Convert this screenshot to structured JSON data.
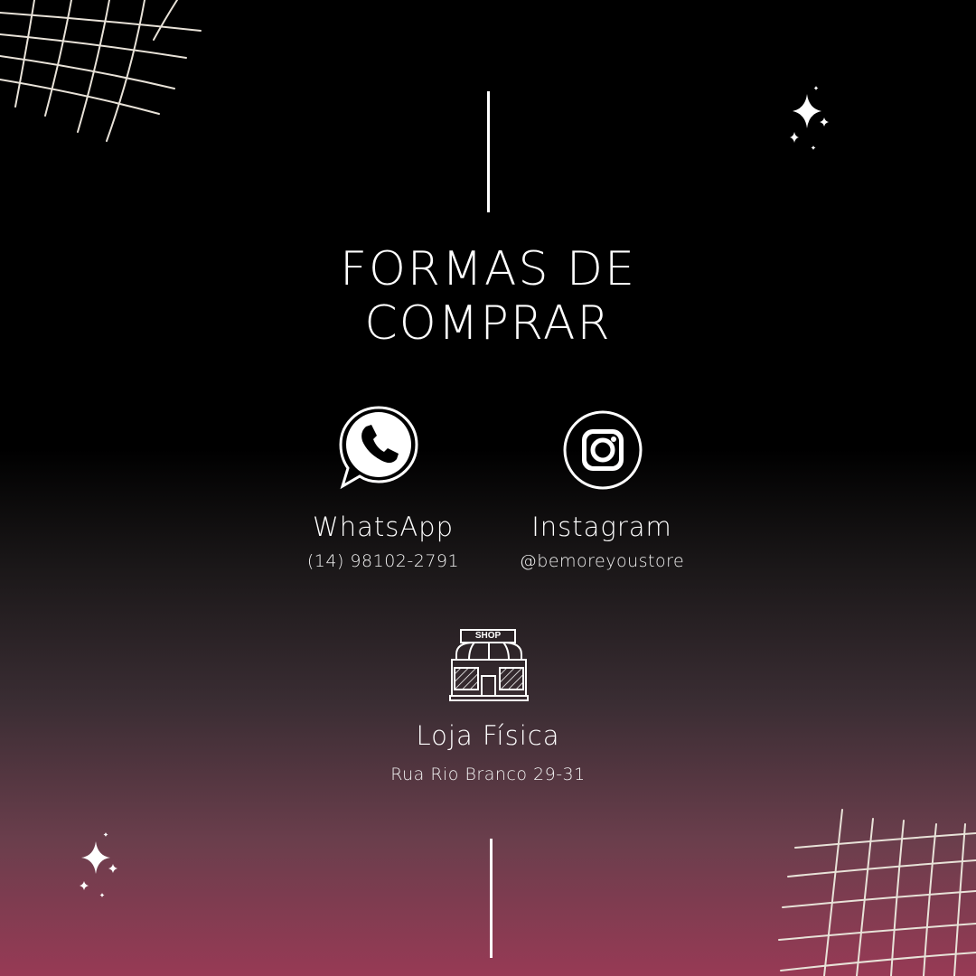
{
  "title": {
    "line1": "FORMAS DE",
    "line2": "COMPRAR"
  },
  "channels": [
    {
      "icon": "whatsapp-icon",
      "label": "WhatsApp",
      "detail": "(14) 98102-2791"
    },
    {
      "icon": "instagram-icon",
      "label": "Instagram",
      "detail": "@bemoreyoustore"
    }
  ],
  "store": {
    "icon": "shop-icon",
    "sign": "SHOP",
    "label": "Loja Física",
    "address": "Rua Rio Branco 29-31"
  },
  "colors": {
    "top": "#000000",
    "bottom": "#973a55",
    "grid": "#e8e2d8",
    "text": "#ffffff"
  }
}
